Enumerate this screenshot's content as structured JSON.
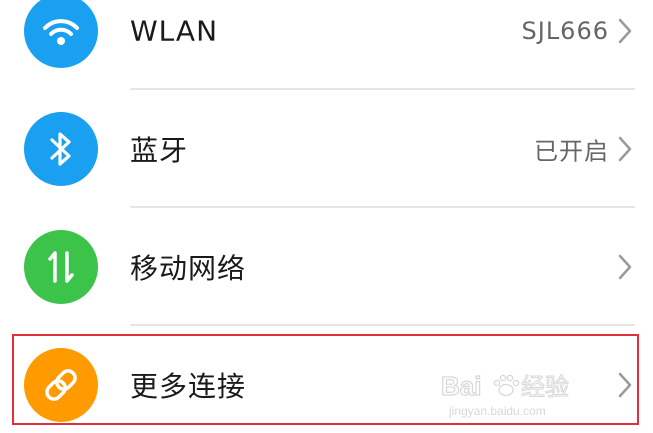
{
  "settings": {
    "items": [
      {
        "label": "WLAN",
        "value": "SJL666",
        "icon": "wifi-icon",
        "color": "#1aa0f0"
      },
      {
        "label": "蓝牙",
        "value": "已开启",
        "icon": "bluetooth-icon",
        "color": "#1aa0f0"
      },
      {
        "label": "移动网络",
        "value": "",
        "icon": "mobile-data-icon",
        "color": "#3cc34a"
      },
      {
        "label": "更多连接",
        "value": "",
        "icon": "link-icon",
        "color": "#ff9a00"
      }
    ]
  },
  "colors": {
    "highlight": "#e0303c",
    "divider": "#e6e6e6"
  },
  "watermark": {
    "brand": "Baidu经验",
    "url": "jingyan.baidu.com"
  }
}
